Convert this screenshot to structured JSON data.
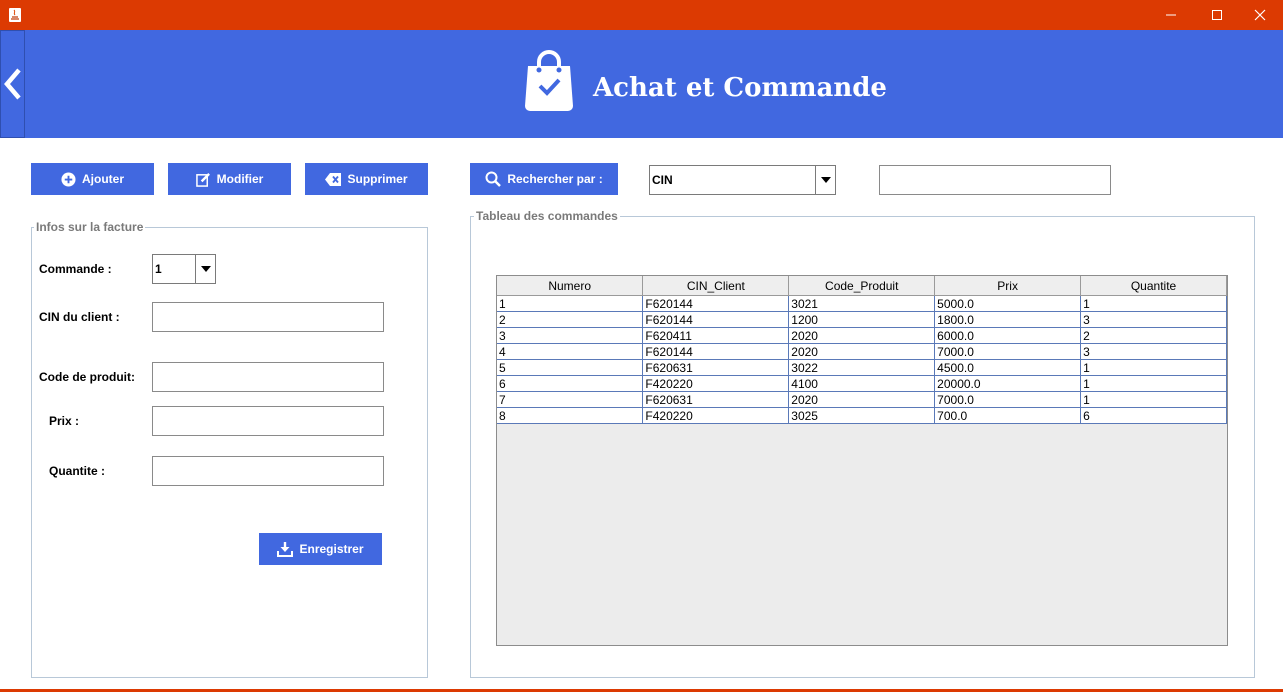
{
  "header": {
    "title": "Achat et Commande"
  },
  "toolbar": {
    "add_label": "Ajouter",
    "edit_label": "Modifier",
    "delete_label": "Supprimer",
    "search_label": "Rechercher par :",
    "search_by_value": "CIN",
    "search_text": ""
  },
  "invoice_form": {
    "legend": "Infos sur la facture",
    "order_label": "Commande :",
    "order_value": "1",
    "client_cin_label": "CIN du client :",
    "client_cin_value": "",
    "product_code_label": "Code de produit:",
    "product_code_value": "",
    "price_label": "Prix :",
    "price_value": "",
    "quantity_label": "Quantite :",
    "quantity_value": "",
    "save_label": "Enregistrer"
  },
  "orders_table": {
    "legend": "Tableau des commandes",
    "columns": [
      "Numero",
      "CIN_Client",
      "Code_Produit",
      "Prix",
      "Quantite"
    ],
    "rows": [
      [
        "1",
        "F620144",
        "3021",
        "5000.0",
        "1"
      ],
      [
        "2",
        "F620144",
        "1200",
        "1800.0",
        "3"
      ],
      [
        "3",
        "F620411",
        "2020",
        "6000.0",
        "2"
      ],
      [
        "4",
        "F620144",
        "2020",
        "7000.0",
        "3"
      ],
      [
        "5",
        "F620631",
        "3022",
        "4500.0",
        "1"
      ],
      [
        "6",
        "F420220",
        "4100",
        "20000.0",
        "1"
      ],
      [
        "7",
        "F620631",
        "2020",
        "7000.0",
        "1"
      ],
      [
        "8",
        "F420220",
        "3025",
        "700.0",
        "6"
      ]
    ]
  },
  "colors": {
    "titlebar": "#dc3a02",
    "header": "#4168e0",
    "button": "#4168e0"
  }
}
